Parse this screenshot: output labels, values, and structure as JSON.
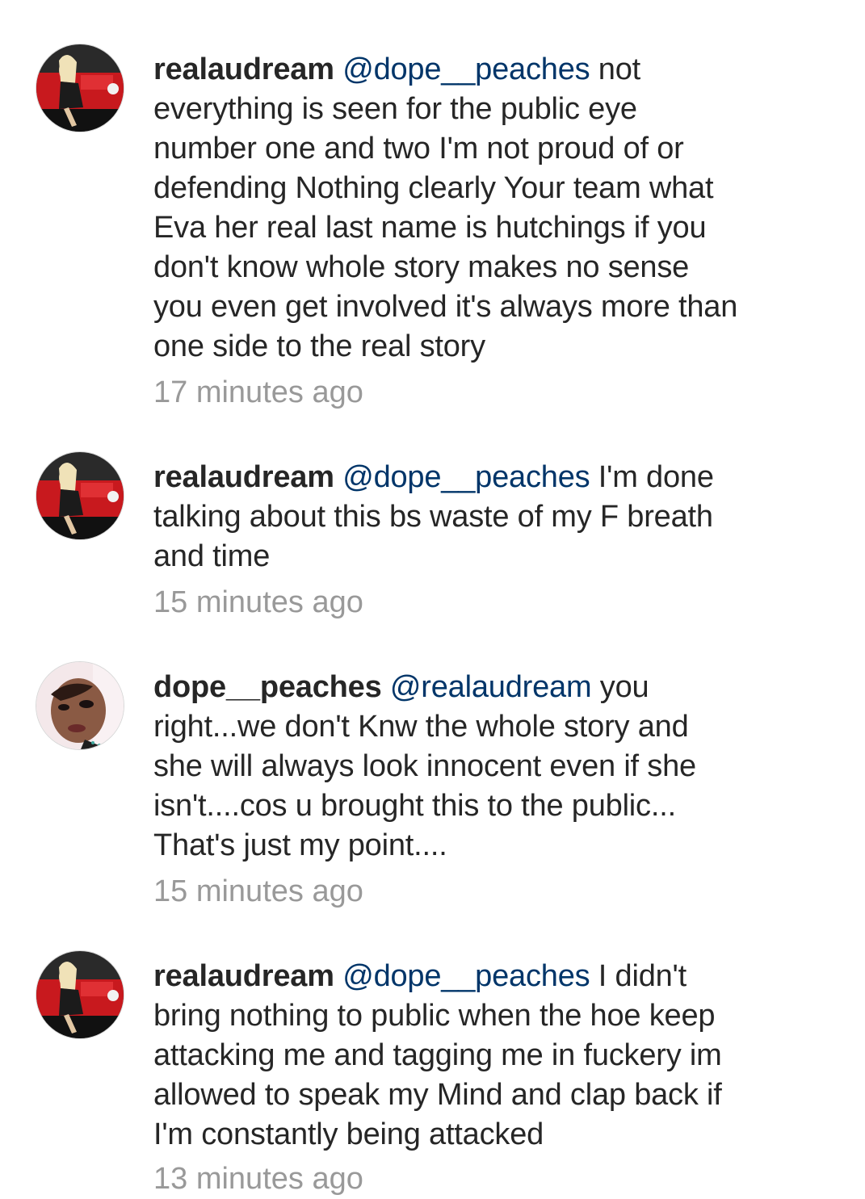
{
  "comments": [
    {
      "username": "realaudream",
      "mention": "@dope__peaches",
      "text": "not\neverything is seen for  the public eye\nnumber one and two I'm not proud of or\ndefending Nothing clearly Your team what\nEva her real last name is hutchings  if you\ndon't know whole story makes no sense\nyou even get involved it's always more than\none side to the real story",
      "time": "17 minutes ago",
      "avatar": "realaudream-avatar"
    },
    {
      "username": "realaudream",
      "mention": "@dope__peaches",
      "text": "I'm done\ntalking about this bs waste of my F breath\nand time",
      "time": "15 minutes ago",
      "avatar": "realaudream-avatar"
    },
    {
      "username": "dope__peaches",
      "mention": "@realaudream",
      "text": "you\nright...we don't Knw the whole story and\nshe will always look innocent even if she\nisn't....cos u brought this to the public...\nThat's just my point....",
      "time": "15 minutes ago",
      "avatar": "dope__peaches-avatar"
    },
    {
      "username": "realaudream",
      "mention": "@dope__peaches",
      "text": "I didn't\nbring nothing to public when the hoe keep\nattacking me and tagging me in fuckery im\nallowed to speak my Mind and clap back if\nI'm constantly being attacked",
      "time": "13 minutes ago",
      "avatar": "realaudream-avatar"
    }
  ],
  "colors": {
    "text": "#262626",
    "mention": "#003569",
    "timestamp": "#999999",
    "background": "#ffffff"
  }
}
